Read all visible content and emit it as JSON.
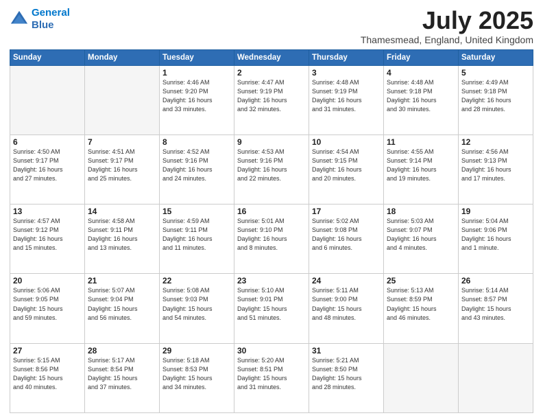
{
  "header": {
    "logo_line1": "General",
    "logo_line2": "Blue",
    "month_title": "July 2025",
    "location": "Thamesmead, England, United Kingdom"
  },
  "days_of_week": [
    "Sunday",
    "Monday",
    "Tuesday",
    "Wednesday",
    "Thursday",
    "Friday",
    "Saturday"
  ],
  "weeks": [
    [
      {
        "day": "",
        "info": ""
      },
      {
        "day": "",
        "info": ""
      },
      {
        "day": "1",
        "info": "Sunrise: 4:46 AM\nSunset: 9:20 PM\nDaylight: 16 hours\nand 33 minutes."
      },
      {
        "day": "2",
        "info": "Sunrise: 4:47 AM\nSunset: 9:19 PM\nDaylight: 16 hours\nand 32 minutes."
      },
      {
        "day": "3",
        "info": "Sunrise: 4:48 AM\nSunset: 9:19 PM\nDaylight: 16 hours\nand 31 minutes."
      },
      {
        "day": "4",
        "info": "Sunrise: 4:48 AM\nSunset: 9:18 PM\nDaylight: 16 hours\nand 30 minutes."
      },
      {
        "day": "5",
        "info": "Sunrise: 4:49 AM\nSunset: 9:18 PM\nDaylight: 16 hours\nand 28 minutes."
      }
    ],
    [
      {
        "day": "6",
        "info": "Sunrise: 4:50 AM\nSunset: 9:17 PM\nDaylight: 16 hours\nand 27 minutes."
      },
      {
        "day": "7",
        "info": "Sunrise: 4:51 AM\nSunset: 9:17 PM\nDaylight: 16 hours\nand 25 minutes."
      },
      {
        "day": "8",
        "info": "Sunrise: 4:52 AM\nSunset: 9:16 PM\nDaylight: 16 hours\nand 24 minutes."
      },
      {
        "day": "9",
        "info": "Sunrise: 4:53 AM\nSunset: 9:16 PM\nDaylight: 16 hours\nand 22 minutes."
      },
      {
        "day": "10",
        "info": "Sunrise: 4:54 AM\nSunset: 9:15 PM\nDaylight: 16 hours\nand 20 minutes."
      },
      {
        "day": "11",
        "info": "Sunrise: 4:55 AM\nSunset: 9:14 PM\nDaylight: 16 hours\nand 19 minutes."
      },
      {
        "day": "12",
        "info": "Sunrise: 4:56 AM\nSunset: 9:13 PM\nDaylight: 16 hours\nand 17 minutes."
      }
    ],
    [
      {
        "day": "13",
        "info": "Sunrise: 4:57 AM\nSunset: 9:12 PM\nDaylight: 16 hours\nand 15 minutes."
      },
      {
        "day": "14",
        "info": "Sunrise: 4:58 AM\nSunset: 9:11 PM\nDaylight: 16 hours\nand 13 minutes."
      },
      {
        "day": "15",
        "info": "Sunrise: 4:59 AM\nSunset: 9:11 PM\nDaylight: 16 hours\nand 11 minutes."
      },
      {
        "day": "16",
        "info": "Sunrise: 5:01 AM\nSunset: 9:10 PM\nDaylight: 16 hours\nand 8 minutes."
      },
      {
        "day": "17",
        "info": "Sunrise: 5:02 AM\nSunset: 9:08 PM\nDaylight: 16 hours\nand 6 minutes."
      },
      {
        "day": "18",
        "info": "Sunrise: 5:03 AM\nSunset: 9:07 PM\nDaylight: 16 hours\nand 4 minutes."
      },
      {
        "day": "19",
        "info": "Sunrise: 5:04 AM\nSunset: 9:06 PM\nDaylight: 16 hours\nand 1 minute."
      }
    ],
    [
      {
        "day": "20",
        "info": "Sunrise: 5:06 AM\nSunset: 9:05 PM\nDaylight: 15 hours\nand 59 minutes."
      },
      {
        "day": "21",
        "info": "Sunrise: 5:07 AM\nSunset: 9:04 PM\nDaylight: 15 hours\nand 56 minutes."
      },
      {
        "day": "22",
        "info": "Sunrise: 5:08 AM\nSunset: 9:03 PM\nDaylight: 15 hours\nand 54 minutes."
      },
      {
        "day": "23",
        "info": "Sunrise: 5:10 AM\nSunset: 9:01 PM\nDaylight: 15 hours\nand 51 minutes."
      },
      {
        "day": "24",
        "info": "Sunrise: 5:11 AM\nSunset: 9:00 PM\nDaylight: 15 hours\nand 48 minutes."
      },
      {
        "day": "25",
        "info": "Sunrise: 5:13 AM\nSunset: 8:59 PM\nDaylight: 15 hours\nand 46 minutes."
      },
      {
        "day": "26",
        "info": "Sunrise: 5:14 AM\nSunset: 8:57 PM\nDaylight: 15 hours\nand 43 minutes."
      }
    ],
    [
      {
        "day": "27",
        "info": "Sunrise: 5:15 AM\nSunset: 8:56 PM\nDaylight: 15 hours\nand 40 minutes."
      },
      {
        "day": "28",
        "info": "Sunrise: 5:17 AM\nSunset: 8:54 PM\nDaylight: 15 hours\nand 37 minutes."
      },
      {
        "day": "29",
        "info": "Sunrise: 5:18 AM\nSunset: 8:53 PM\nDaylight: 15 hours\nand 34 minutes."
      },
      {
        "day": "30",
        "info": "Sunrise: 5:20 AM\nSunset: 8:51 PM\nDaylight: 15 hours\nand 31 minutes."
      },
      {
        "day": "31",
        "info": "Sunrise: 5:21 AM\nSunset: 8:50 PM\nDaylight: 15 hours\nand 28 minutes."
      },
      {
        "day": "",
        "info": ""
      },
      {
        "day": "",
        "info": ""
      }
    ]
  ]
}
